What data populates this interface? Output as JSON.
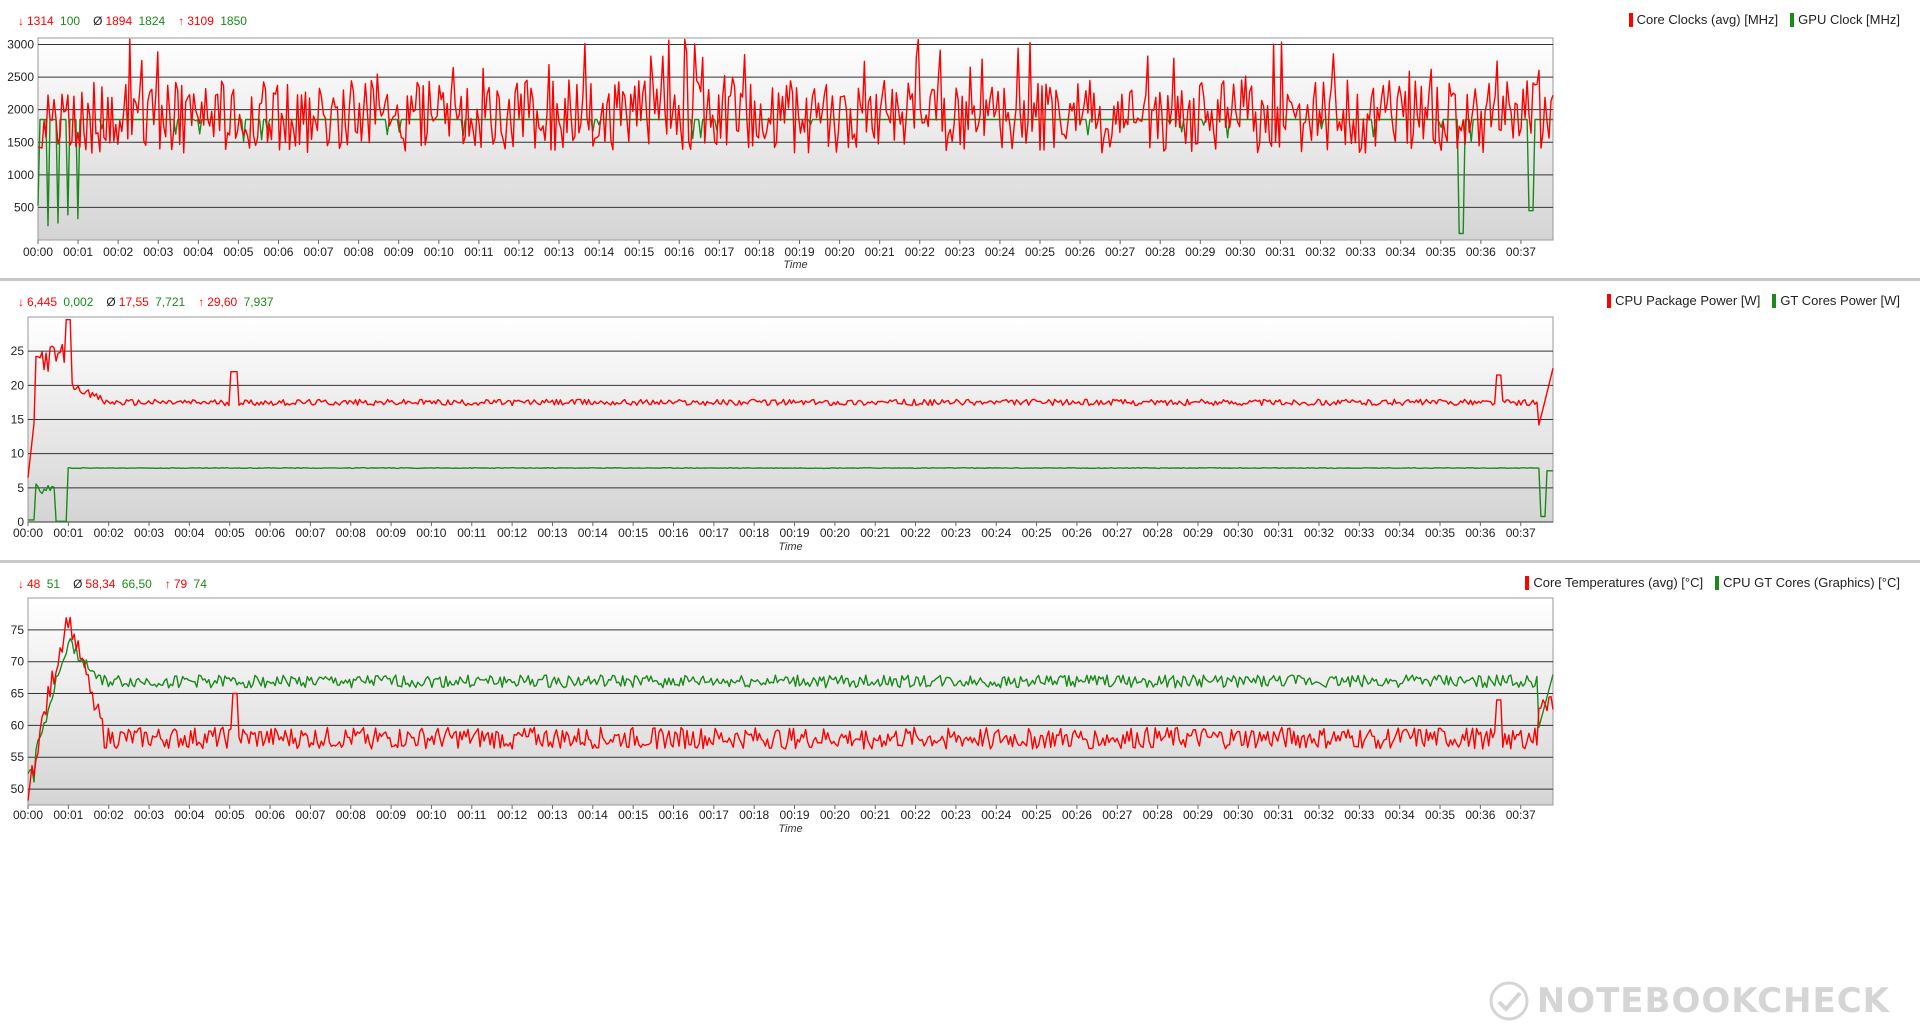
{
  "colors": {
    "red": "#ff0000",
    "green": "#1a8a1a",
    "grid": "#333333",
    "plotTop": "#ffffff",
    "plotBottom": "#d4d4d4"
  },
  "watermark": {
    "text": "NOTEBOOKCHECK",
    "icon": "notebookcheck-logo-icon"
  },
  "chart_data": [
    {
      "type": "line",
      "stats": {
        "min_symbol": "↓",
        "min_a": "1314",
        "min_b": "100",
        "avg_symbol": "Ø",
        "avg_a": "1894",
        "avg_b": "1824",
        "max_symbol": "↑",
        "max_a": "3109",
        "max_b": "1850"
      },
      "xlabel": "Time",
      "x_ticks": [
        "00:00",
        "00:01",
        "00:02",
        "00:03",
        "00:04",
        "00:05",
        "00:06",
        "00:07",
        "00:08",
        "00:09",
        "00:10",
        "00:11",
        "00:12",
        "00:13",
        "00:14",
        "00:15",
        "00:16",
        "00:17",
        "00:18",
        "00:19",
        "00:20",
        "00:21",
        "00:22",
        "00:23",
        "00:24",
        "00:25",
        "00:26",
        "00:27",
        "00:28",
        "00:29",
        "00:30",
        "00:31",
        "00:32",
        "00:33",
        "00:34",
        "00:35",
        "00:36",
        "00:37"
      ],
      "x_range_minutes": [
        0,
        37.8
      ],
      "y_ticks": [
        500,
        1000,
        1500,
        2000,
        2500,
        3000
      ],
      "ylim": [
        0,
        3100
      ],
      "series": [
        {
          "name": "Core Clocks (avg) [MHz]",
          "color": "#ff0000",
          "min": 1314,
          "avg": 1894,
          "max": 3109,
          "noise": 420,
          "base": 1894
        },
        {
          "name": "GPU Clock [MHz]",
          "color": "#1a8a1a",
          "min": 100,
          "avg": 1824,
          "max": 1850,
          "base": 1850
        }
      ]
    },
    {
      "type": "line",
      "stats": {
        "min_symbol": "↓",
        "min_a": "6,445",
        "min_b": "0,002",
        "avg_symbol": "Ø",
        "avg_a": "17,55",
        "avg_b": "7,721",
        "max_symbol": "↑",
        "max_a": "29,60",
        "max_b": "7,937"
      },
      "xlabel": "Time",
      "x_ticks": [
        "00:00",
        "00:01",
        "00:02",
        "00:03",
        "00:04",
        "00:05",
        "00:06",
        "00:07",
        "00:08",
        "00:09",
        "00:10",
        "00:11",
        "00:12",
        "00:13",
        "00:14",
        "00:15",
        "00:16",
        "00:17",
        "00:18",
        "00:19",
        "00:20",
        "00:21",
        "00:22",
        "00:23",
        "00:24",
        "00:25",
        "00:26",
        "00:27",
        "00:28",
        "00:29",
        "00:30",
        "00:31",
        "00:32",
        "00:33",
        "00:34",
        "00:35",
        "00:36",
        "00:37"
      ],
      "x_range_minutes": [
        0,
        37.8
      ],
      "y_ticks": [
        0,
        5,
        10,
        15,
        20,
        25
      ],
      "ylim": [
        0,
        30
      ],
      "series": [
        {
          "name": "CPU Package Power [W]",
          "color": "#ff0000",
          "min": 6.445,
          "avg": 17.55,
          "max": 29.6,
          "base": 17.5
        },
        {
          "name": "GT Cores Power [W]",
          "color": "#1a8a1a",
          "min": 0.002,
          "avg": 7.721,
          "max": 7.937,
          "base": 7.9
        }
      ]
    },
    {
      "type": "line",
      "stats": {
        "min_symbol": "↓",
        "min_a": "48",
        "min_b": "51",
        "avg_symbol": "Ø",
        "avg_a": "58,34",
        "avg_b": "66,50",
        "max_symbol": "↑",
        "max_a": "79",
        "max_b": "74"
      },
      "xlabel": "Time",
      "x_ticks": [
        "00:00",
        "00:01",
        "00:02",
        "00:03",
        "00:04",
        "00:05",
        "00:06",
        "00:07",
        "00:08",
        "00:09",
        "00:10",
        "00:11",
        "00:12",
        "00:13",
        "00:14",
        "00:15",
        "00:16",
        "00:17",
        "00:18",
        "00:19",
        "00:20",
        "00:21",
        "00:22",
        "00:23",
        "00:24",
        "00:25",
        "00:26",
        "00:27",
        "00:28",
        "00:29",
        "00:30",
        "00:31",
        "00:32",
        "00:33",
        "00:34",
        "00:35",
        "00:36",
        "00:37"
      ],
      "x_range_minutes": [
        0,
        37.8
      ],
      "y_ticks": [
        50,
        55,
        60,
        65,
        70,
        75
      ],
      "ylim": [
        47.5,
        80
      ],
      "series": [
        {
          "name": "Core Temperatures (avg) [°C]",
          "color": "#ff0000",
          "min": 48,
          "avg": 58.34,
          "max": 79,
          "base": 58
        },
        {
          "name": "CPU GT Cores (Graphics) [°C]",
          "color": "#1a8a1a",
          "min": 51,
          "avg": 66.5,
          "max": 74,
          "base": 66.5
        }
      ]
    }
  ]
}
